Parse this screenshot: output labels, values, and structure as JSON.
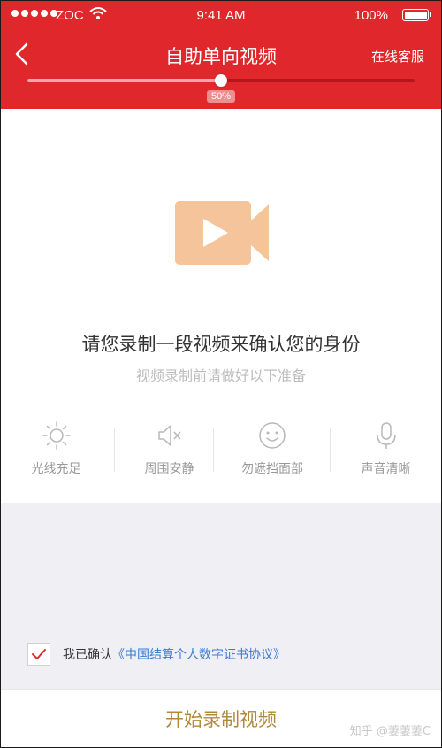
{
  "status_bar": {
    "carrier": "ZOC",
    "time": "9:41 AM",
    "battery": "100%"
  },
  "nav": {
    "title": "自助单向视频",
    "right_action": "在线客服"
  },
  "progress": {
    "value": 0.5,
    "label": "50%"
  },
  "main": {
    "prompt": "请您录制一段视频来确认您的身份",
    "sub_prompt": "视频录制前请做好以下准备"
  },
  "tips": [
    {
      "label": "光线充足",
      "icon": "sun-icon"
    },
    {
      "label": "周围安静",
      "icon": "mute-icon"
    },
    {
      "label": "勿遮挡面部",
      "icon": "face-icon"
    },
    {
      "label": "声音清晰",
      "icon": "microphone-icon"
    }
  ],
  "agreement": {
    "prefix": "我已确认",
    "link": "《中国结算个人数字证书协议》",
    "checked": true
  },
  "action": {
    "start_label": "开始录制视频"
  },
  "watermark": "知乎 @萋萋萋C",
  "colors": {
    "brand_red": "#e0282c",
    "video_icon": "#f5c49a",
    "check": "#e0282c",
    "link": "#3a7bd5",
    "start_button_text": "#b08a3a"
  }
}
